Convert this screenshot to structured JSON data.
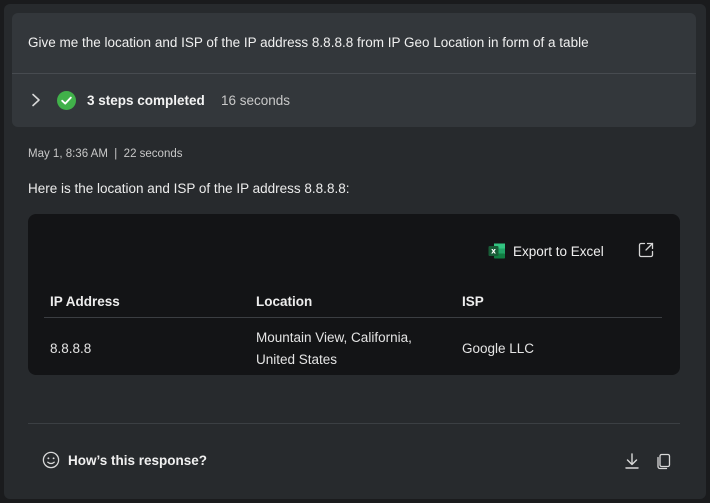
{
  "prompt": {
    "text": "Give me the location and ISP of the IP address 8.8.8.8 from IP Geo Location in form of a table"
  },
  "steps": {
    "label": "3 steps completed",
    "duration": "16 seconds"
  },
  "response": {
    "meta": "May 1, 8:36 AM  |  22 seconds",
    "intro": "Here is the location and ISP of the IP address 8.8.8.8:"
  },
  "table": {
    "export_label": "Export to Excel",
    "headers": [
      "IP Address",
      "Location",
      "ISP"
    ],
    "rows": [
      [
        "8.8.8.8",
        "Mountain View, California, United States",
        "Google LLC"
      ]
    ]
  },
  "footer": {
    "feedback_label": "How’s this response?"
  },
  "icons": {
    "chevron": "chevron-right-icon",
    "check": "check-circle-icon",
    "excel": "excel-icon",
    "expand": "expand-icon",
    "smile": "smile-icon",
    "download": "download-icon",
    "copy": "copy-icon"
  },
  "colors": {
    "success": "#41b14a",
    "excel_green": "#1d7a45"
  }
}
